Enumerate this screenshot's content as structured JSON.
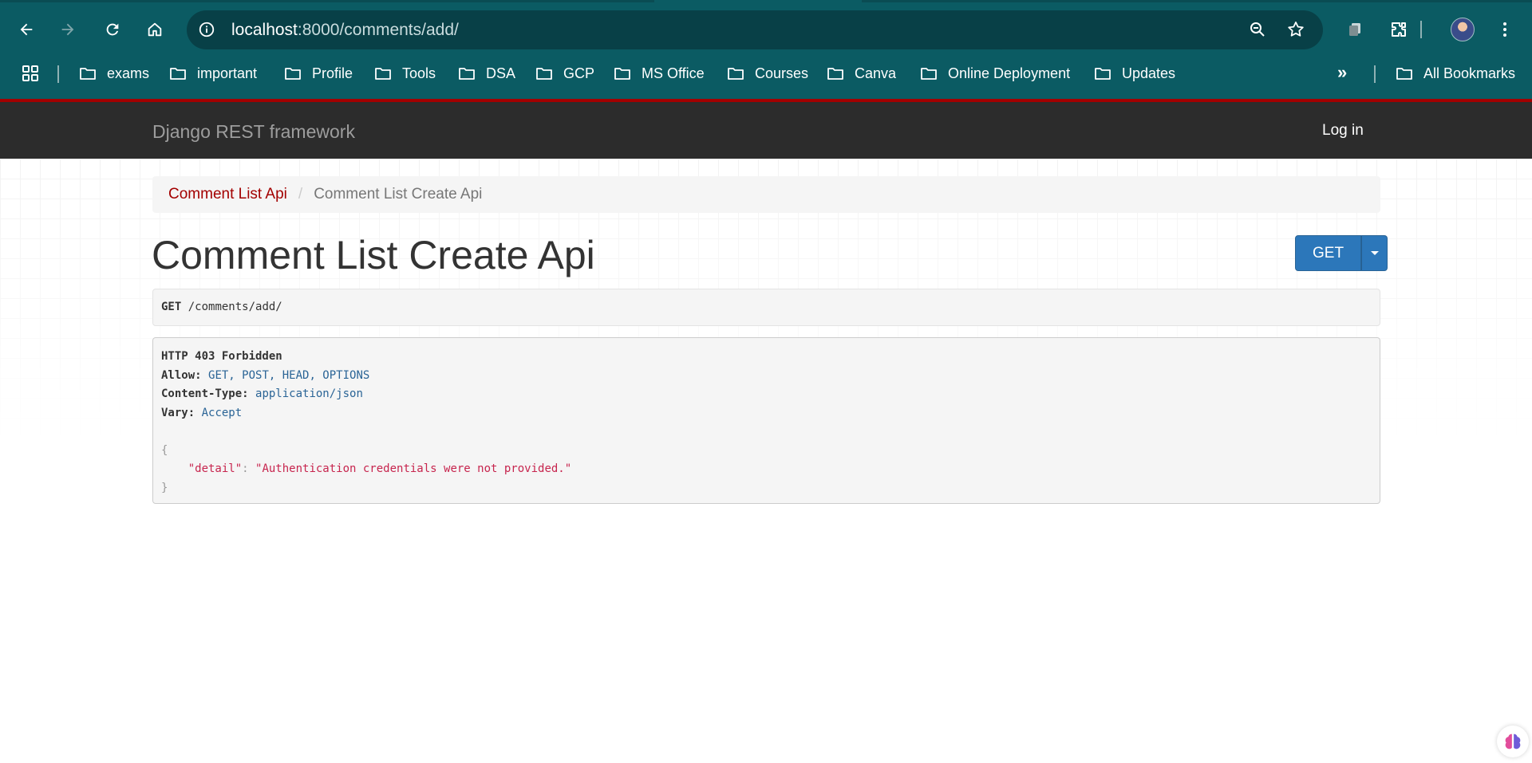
{
  "browser": {
    "url_host": "localhost",
    "url_path": ":8000/comments/add/",
    "bookmarks": [
      {
        "label": "exams"
      },
      {
        "label": "important"
      },
      {
        "label": "Profile"
      },
      {
        "label": "Tools"
      },
      {
        "label": "DSA"
      },
      {
        "label": "GCP"
      },
      {
        "label": "MS Office"
      },
      {
        "label": "Courses"
      },
      {
        "label": "Canva"
      },
      {
        "label": "Online Deployment"
      },
      {
        "label": "Updates"
      }
    ],
    "more_bookmarks": "»",
    "all_bookmarks": "All Bookmarks",
    "colors": {
      "chrome_bg": "#0b5b63",
      "omnibox_bg": "#084047",
      "accent_red": "#a30000"
    }
  },
  "navbar": {
    "brand": "Django REST framework",
    "login": "Log in"
  },
  "breadcrumb": {
    "link": "Comment List Api",
    "separator": "/",
    "active": "Comment List Create Api"
  },
  "page": {
    "title": "Comment List Create Api",
    "method_button": "GET"
  },
  "request": {
    "method": "GET",
    "path": "/comments/add/"
  },
  "response": {
    "status": "HTTP 403 Forbidden",
    "headers": [
      {
        "key": "Allow:",
        "value": "GET, POST, HEAD, OPTIONS"
      },
      {
        "key": "Content-Type:",
        "value": "application/json"
      },
      {
        "key": "Vary:",
        "value": "Accept"
      }
    ],
    "body": {
      "open": "{",
      "key": "\"detail\"",
      "colon": ": ",
      "value": "\"Authentication credentials were not provided.\"",
      "close": "}"
    }
  }
}
